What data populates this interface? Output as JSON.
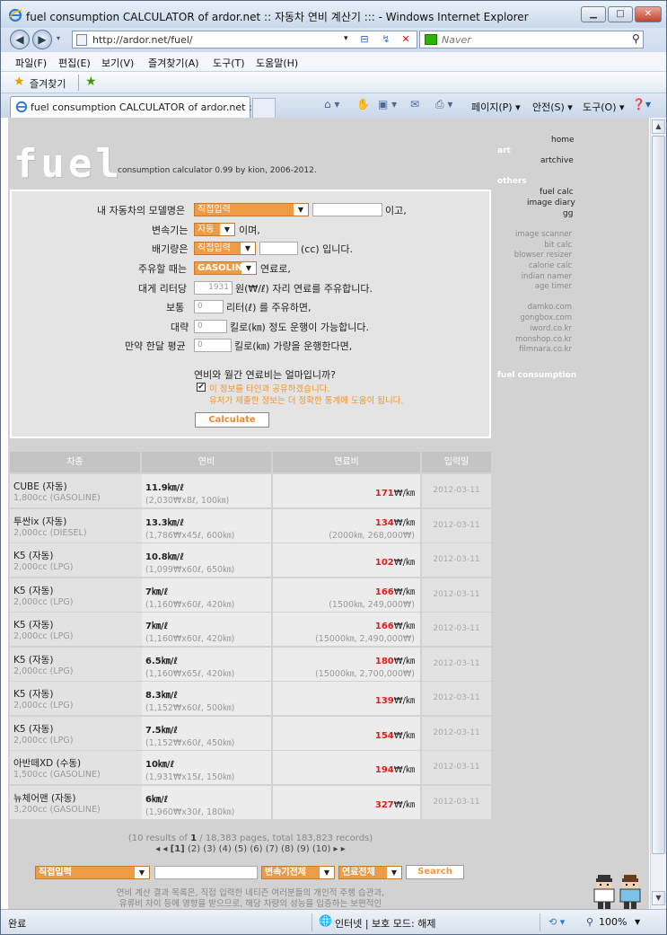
{
  "window": {
    "title": "fuel consumption CALCULATOR of ardor.net :: 자동차 연비 계산기 ::: - Windows Internet Explorer"
  },
  "address": {
    "url": "http://ardor.net/fuel/",
    "search_placeholder": "Naver"
  },
  "menu": [
    "파일(F)",
    "편집(E)",
    "보기(V)",
    "즐겨찾기(A)",
    "도구(T)",
    "도움말(H)"
  ],
  "favorites": {
    "label": "즐겨찾기"
  },
  "tab": {
    "title": "fuel consumption CALCULATOR of ardor.net :: ..."
  },
  "toolbar": {
    "page": "페이지(P) ▾",
    "safety": "안전(S) ▾",
    "tools": "도구(O) ▾"
  },
  "site": {
    "logo": "fuel",
    "subtitle": "consumption calculator 0.99 by kion, 2006-2012.",
    "nav_top": {
      "home": "home",
      "art": "art",
      "archive": "artchive"
    },
    "others_label": "others",
    "others": [
      "fuel calc",
      "image diary",
      "gg"
    ],
    "tools": [
      "image scanner",
      "bit calc",
      "blowser resizer",
      "calorie calc",
      "indian namer",
      "age timer"
    ],
    "links": [
      "damko.com",
      "gongbox.com",
      "iword.co.kr",
      "monshop.co.kr",
      "filmnara.co.kr"
    ],
    "fuel_consumption_label": "fuel consumption"
  },
  "form": {
    "model_label": "내 자동차의 모델명은",
    "model_select": "직접입력",
    "model_suffix": "이고,",
    "trans_label": "변속기는",
    "trans_select": "자동",
    "trans_suffix": "이며,",
    "disp_label": "배기량은",
    "disp_select": "직접입력",
    "disp_suffix": "(cc) 입니다.",
    "fuel_label": "주유할 때는",
    "fuel_select": "GASOLINE",
    "fuel_suffix": "연료로,",
    "price_label": "대게 리터당",
    "price_value": "1931",
    "price_suffix": "원(₩/ℓ) 자리 연료를 주유합니다.",
    "liters_label": "보통",
    "liters_value": "0",
    "liters_suffix": "리터(ℓ) 를 주유하면,",
    "km_label": "대략",
    "km_value": "0",
    "km_suffix": "킬로(㎞) 정도 운행이 가능합니다.",
    "month_label": "만약 한달 평균",
    "month_value": "0",
    "month_suffix": "킬로(㎞) 가량을 운행한다면,",
    "question": "연비와 월간 연료비는 얼마입니까?",
    "share_check": "✔",
    "share_label": "이 정보를 타인과 공유하겠습니다.",
    "share_note": "유저가 제출한 정보는 더 정확한 통계에 도움이 됩니다.",
    "calculate": "Calculate"
  },
  "table": {
    "headers": [
      "차종",
      "연비",
      "연료비",
      "입력일"
    ],
    "rows": [
      {
        "car": "CUBE (자동)",
        "spec": "1,800cc (GASOLINE)",
        "eff": "11.9㎞/ℓ",
        "eff_detail": "(2,030₩x8ℓ, 100㎞)",
        "cost": "171",
        "cost_unit": "₩/㎞",
        "cost_detail": "",
        "date": "2012-03-11"
      },
      {
        "car": "투싼ix (자동)",
        "spec": "2,000cc (DIESEL)",
        "eff": "13.3㎞/ℓ",
        "eff_detail": "(1,786₩x45ℓ, 600㎞)",
        "cost": "134",
        "cost_unit": "₩/㎞",
        "cost_detail": "(2000㎞, 268,000₩)",
        "date": "2012-03-11"
      },
      {
        "car": "K5 (자동)",
        "spec": "2,000cc (LPG)",
        "eff": "10.8㎞/ℓ",
        "eff_detail": "(1,099₩x60ℓ, 650㎞)",
        "cost": "102",
        "cost_unit": "₩/㎞",
        "cost_detail": "",
        "date": "2012-03-11"
      },
      {
        "car": "K5 (자동)",
        "spec": "2,000cc (LPG)",
        "eff": "7㎞/ℓ",
        "eff_detail": "(1,160₩x60ℓ, 420㎞)",
        "cost": "166",
        "cost_unit": "₩/㎞",
        "cost_detail": "(1500㎞, 249,000₩)",
        "date": "2012-03-11"
      },
      {
        "car": "K5 (자동)",
        "spec": "2,000cc (LPG)",
        "eff": "7㎞/ℓ",
        "eff_detail": "(1,160₩x60ℓ, 420㎞)",
        "cost": "166",
        "cost_unit": "₩/㎞",
        "cost_detail": "(15000㎞, 2,490,000₩)",
        "date": "2012-03-11"
      },
      {
        "car": "K5 (자동)",
        "spec": "2,000cc (LPG)",
        "eff": "6.5㎞/ℓ",
        "eff_detail": "(1,160₩x65ℓ, 420㎞)",
        "cost": "180",
        "cost_unit": "₩/㎞",
        "cost_detail": "(15000㎞, 2,700,000₩)",
        "date": "2012-03-11"
      },
      {
        "car": "K5 (자동)",
        "spec": "2,000cc (LPG)",
        "eff": "8.3㎞/ℓ",
        "eff_detail": "(1,152₩x60ℓ, 500㎞)",
        "cost": "139",
        "cost_unit": "₩/㎞",
        "cost_detail": "",
        "date": "2012-03-11"
      },
      {
        "car": "K5 (자동)",
        "spec": "2,000cc (LPG)",
        "eff": "7.5㎞/ℓ",
        "eff_detail": "(1,152₩x60ℓ, 450㎞)",
        "cost": "154",
        "cost_unit": "₩/㎞",
        "cost_detail": "",
        "date": "2012-03-11"
      },
      {
        "car": "아반떼XD (수동)",
        "spec": "1,500cc (GASOLINE)",
        "eff": "10㎞/ℓ",
        "eff_detail": "(1,931₩x15ℓ, 150㎞)",
        "cost": "194",
        "cost_unit": "₩/㎞",
        "cost_detail": "",
        "date": "2012-03-11"
      },
      {
        "car": "뉴체어맨 (자동)",
        "spec": "3,200cc (GASOLINE)",
        "eff": "6㎞/ℓ",
        "eff_detail": "(1,960₩x30ℓ, 180㎞)",
        "cost": "327",
        "cost_unit": "₩/㎞",
        "cost_detail": "",
        "date": "2012-03-11"
      }
    ]
  },
  "pagination": {
    "info_pre": "(10 results of ",
    "current_bold": "1",
    "info_post": " / 18,383 pages, total 183,823 records)",
    "first": "◂",
    "prev": "◂",
    "current": "[1]",
    "pages": [
      "(2)",
      "(3)",
      "(4)",
      "(5)",
      "(6)",
      "(7)",
      "(8)",
      "(9)",
      "(10)"
    ],
    "next": "▸",
    "last": "▸"
  },
  "bottom_search": {
    "model": "직접입력",
    "trans": "변속기전체",
    "fuel": "연료전체",
    "button": "Search"
  },
  "footer": {
    "line1": "연비 계산 결과 목록은, 직접 입력한 네티즌 여러분들의 개인적 주행 습관과,",
    "line2": "유류비 차이 등에 영향을 받으므로, 해당 차량의 성능을 입증하는 보편적인"
  },
  "status": {
    "done": "완료",
    "zone": "인터넷 | 보호 모드: 해제",
    "zoom": "100%"
  }
}
